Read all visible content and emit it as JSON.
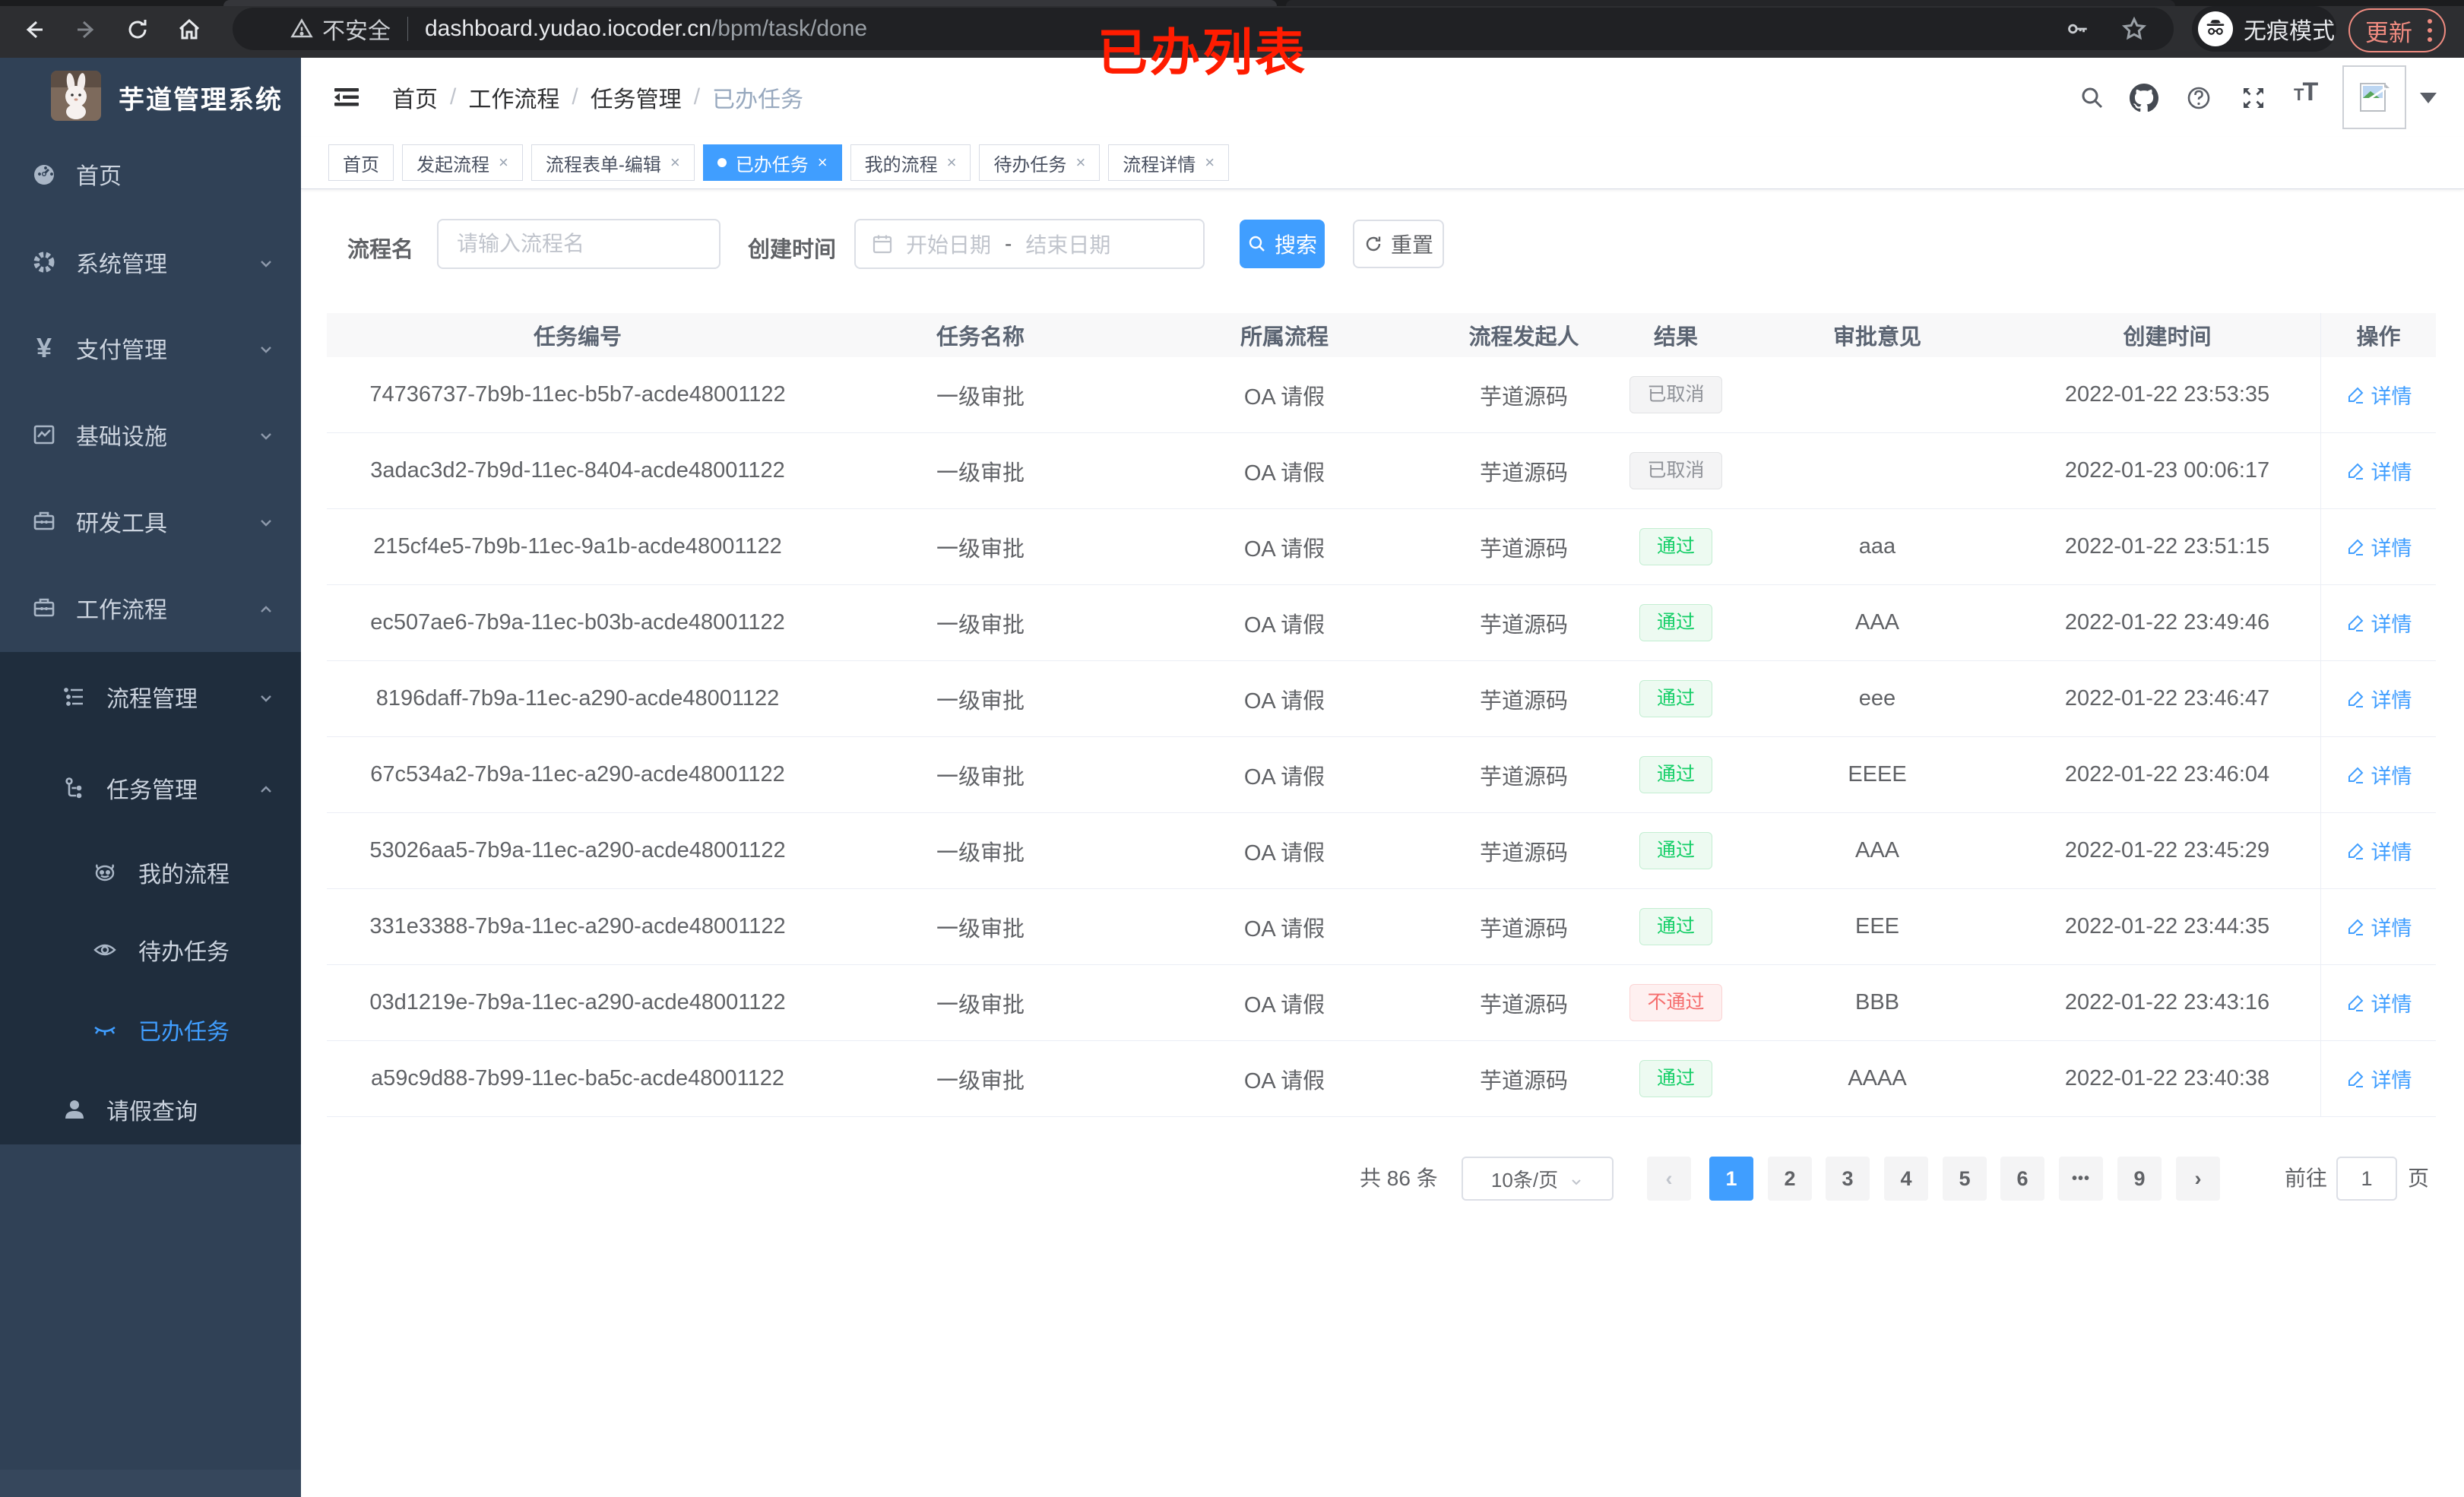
{
  "browser": {
    "security_label": "不安全",
    "url_host": "dashboard.yudao.iocoder.cn",
    "url_path": "/bpm/task/done",
    "incognito_label": "无痕模式",
    "update_label": "更新",
    "annotation": "已办列表"
  },
  "sidebar": {
    "logo_title": "芋道管理系统",
    "items": {
      "home": "首页",
      "system": "系统管理",
      "pay": "支付管理",
      "infra": "基础设施",
      "devtools": "研发工具",
      "workflow": "工作流程",
      "process_mgmt": "流程管理",
      "task_mgmt": "任务管理",
      "my_process": "我的流程",
      "todo_task": "待办任务",
      "done_task": "已办任务",
      "leave_query": "请假查询"
    }
  },
  "header": {
    "breadcrumb": [
      "首页",
      "工作流程",
      "任务管理",
      "已办任务"
    ]
  },
  "tabs": [
    {
      "label": "首页"
    },
    {
      "label": "发起流程"
    },
    {
      "label": "流程表单-编辑"
    },
    {
      "label": "已办任务"
    },
    {
      "label": "我的流程"
    },
    {
      "label": "待办任务"
    },
    {
      "label": "流程详情"
    }
  ],
  "filters": {
    "name_label": "流程名",
    "name_placeholder": "请输入流程名",
    "time_label": "创建时间",
    "start_placeholder": "开始日期",
    "range_separator": "-",
    "end_placeholder": "结束日期",
    "search_label": "搜索",
    "reset_label": "重置"
  },
  "table": {
    "columns": [
      "任务编号",
      "任务名称",
      "所属流程",
      "流程发起人",
      "结果",
      "审批意见",
      "创建时间",
      "操作"
    ],
    "action_label": "详情",
    "rows": [
      {
        "id": "74736737-7b9b-11ec-b5b7-acde48001122",
        "name": "一级审批",
        "process": "OA 请假",
        "starter": "芋道源码",
        "result": "已取消",
        "result_type": "info",
        "comment": "",
        "created": "2022-01-22 23:53:35"
      },
      {
        "id": "3adac3d2-7b9d-11ec-8404-acde48001122",
        "name": "一级审批",
        "process": "OA 请假",
        "starter": "芋道源码",
        "result": "已取消",
        "result_type": "info",
        "comment": "",
        "created": "2022-01-23 00:06:17"
      },
      {
        "id": "215cf4e5-7b9b-11ec-9a1b-acde48001122",
        "name": "一级审批",
        "process": "OA 请假",
        "starter": "芋道源码",
        "result": "通过",
        "result_type": "success",
        "comment": "aaa",
        "created": "2022-01-22 23:51:15"
      },
      {
        "id": "ec507ae6-7b9a-11ec-b03b-acde48001122",
        "name": "一级审批",
        "process": "OA 请假",
        "starter": "芋道源码",
        "result": "通过",
        "result_type": "success",
        "comment": "AAA",
        "created": "2022-01-22 23:49:46"
      },
      {
        "id": "8196daff-7b9a-11ec-a290-acde48001122",
        "name": "一级审批",
        "process": "OA 请假",
        "starter": "芋道源码",
        "result": "通过",
        "result_type": "success",
        "comment": "eee",
        "created": "2022-01-22 23:46:47"
      },
      {
        "id": "67c534a2-7b9a-11ec-a290-acde48001122",
        "name": "一级审批",
        "process": "OA 请假",
        "starter": "芋道源码",
        "result": "通过",
        "result_type": "success",
        "comment": "EEEE",
        "created": "2022-01-22 23:46:04"
      },
      {
        "id": "53026aa5-7b9a-11ec-a290-acde48001122",
        "name": "一级审批",
        "process": "OA 请假",
        "starter": "芋道源码",
        "result": "通过",
        "result_type": "success",
        "comment": "AAA",
        "created": "2022-01-22 23:45:29"
      },
      {
        "id": "331e3388-7b9a-11ec-a290-acde48001122",
        "name": "一级审批",
        "process": "OA 请假",
        "starter": "芋道源码",
        "result": "通过",
        "result_type": "success",
        "comment": "EEE",
        "created": "2022-01-22 23:44:35"
      },
      {
        "id": "03d1219e-7b9a-11ec-a290-acde48001122",
        "name": "一级审批",
        "process": "OA 请假",
        "starter": "芋道源码",
        "result": "不通过",
        "result_type": "danger",
        "comment": "BBB",
        "created": "2022-01-22 23:43:16"
      },
      {
        "id": "a59c9d88-7b99-11ec-ba5c-acde48001122",
        "name": "一级审批",
        "process": "OA 请假",
        "starter": "芋道源码",
        "result": "通过",
        "result_type": "success",
        "comment": "AAAA",
        "created": "2022-01-22 23:40:38"
      }
    ]
  },
  "pagination": {
    "total_label": "共 86 条",
    "page_size": "10条/页",
    "pages": [
      "1",
      "2",
      "3",
      "4",
      "5",
      "6",
      "•••",
      "9"
    ],
    "prev": "‹",
    "next": "›",
    "goto_label": "前往",
    "goto_value": "1",
    "page_unit": "页"
  },
  "colors": {
    "primary": "#409eff",
    "success": "#13ce66",
    "danger": "#f56c6c",
    "info": "#909399",
    "sidebar": "#304156",
    "sidebar_submenu": "#1f2d3d",
    "annotation": "#ff1c00"
  }
}
